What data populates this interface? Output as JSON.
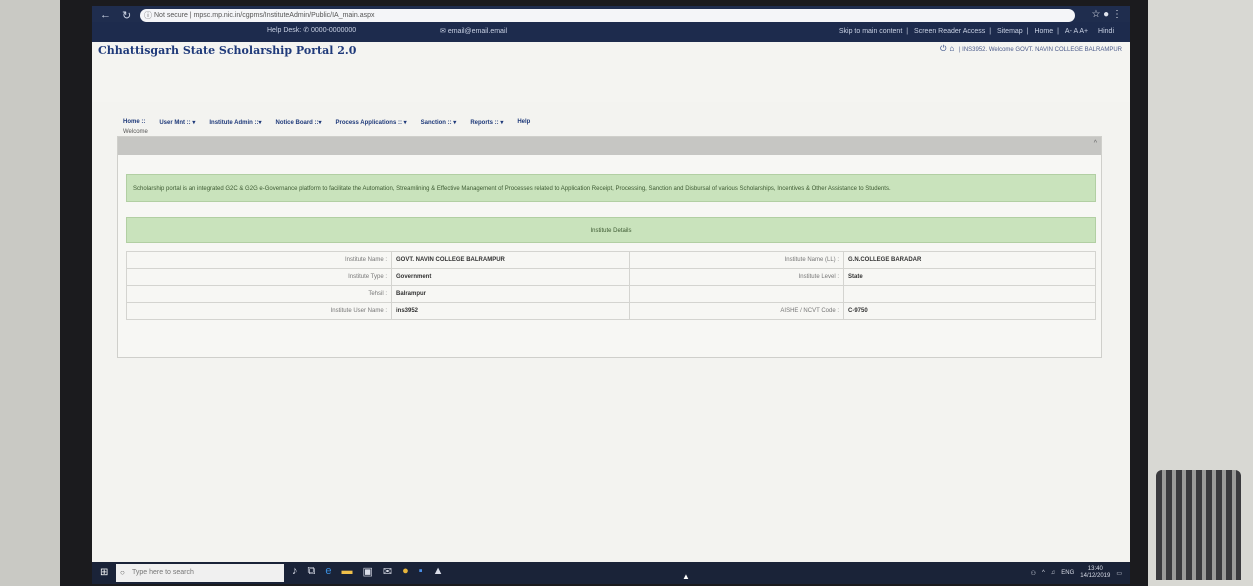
{
  "browser": {
    "url": "mpsc.mp.nic.in/cgpms/InstituteAdmin/Public/IA_main.aspx",
    "security": "Not secure"
  },
  "utility": {
    "helpdesk_label": "Help Desk",
    "helpdesk_phone": "0000-0000000",
    "email": "email@email.email",
    "links": [
      "Skip to main content",
      "Screen Reader Access",
      "Sitemap",
      "Home",
      "A- A A+",
      "Hindi"
    ]
  },
  "header": {
    "title": "Chhattisgarh State Scholarship Portal 2.0",
    "welcome": "| INS3952. Welcome GOVT. NAVIN COLLEGE BALRAMPUR"
  },
  "menu": [
    "Home ::",
    "User Mnt :: ▾",
    "Institute Admin ::▾",
    "Notice Board ::▾",
    "Process Applications :: ▾",
    "Sanction :: ▾",
    "Reports :: ▾",
    "Help"
  ],
  "welcome_tab": "Welcome",
  "info_banner": "Scholarship portal is an integrated G2C & G2G e-Governance platform to facilitate the Automation, Streamlining & Effective Management of Processes related to Application Receipt, Processing, Sanction and Disbursal of various Scholarships, Incentives & Other Assistance to Students.",
  "details_title": "Institute Details",
  "details": {
    "name_label": "Institute Name :",
    "name_value": "GOVT. NAVIN COLLEGE BALRAMPUR",
    "name_ll_label": "Institute Name (LL) :",
    "name_ll_value": "G.N.COLLEGE BARADAR",
    "type_label": "Institute Type :",
    "type_value": "Government",
    "level_label": "Institute Level :",
    "level_value": "State",
    "tehsil_label": "Tehsil :",
    "tehsil_value": "Balrampur",
    "user_label": "Institute User Name :",
    "user_value": "ins3952",
    "aishe_label": "AISHE / NCVT Code :",
    "aishe_value": "C-9750"
  },
  "taskbar": {
    "search_placeholder": "Type here to search",
    "tray_lang": "ENG",
    "time": "13:40",
    "date": "14/12/2019"
  }
}
